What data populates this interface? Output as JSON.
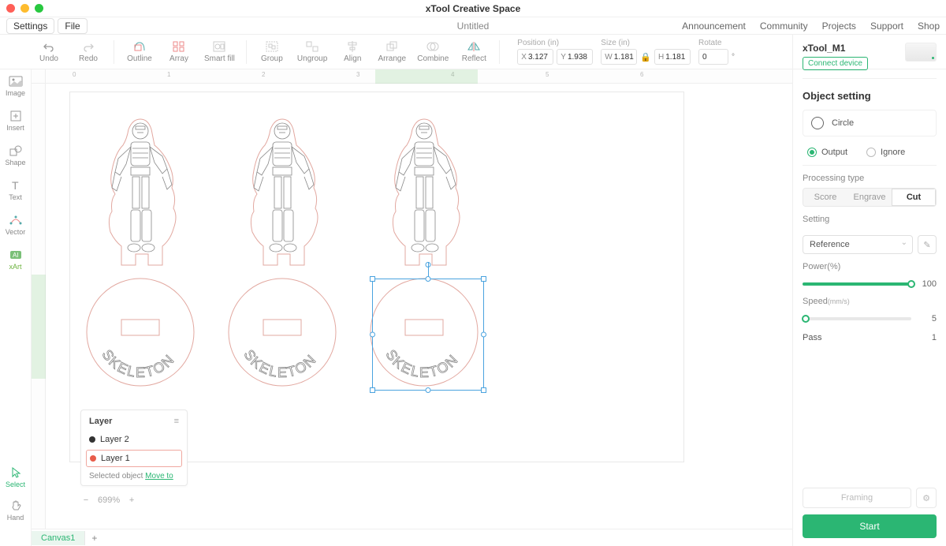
{
  "app": {
    "title": "xTool Creative Space",
    "document": "Untitled"
  },
  "menu": {
    "settings": "Settings",
    "file": "File"
  },
  "top_links": {
    "announcement": "Announcement",
    "community": "Community",
    "projects": "Projects",
    "support": "Support",
    "shop": "Shop"
  },
  "toolbar": {
    "undo": "Undo",
    "redo": "Redo",
    "outline": "Outline",
    "array": "Array",
    "smartfill": "Smart fill",
    "group": "Group",
    "ungroup": "Ungroup",
    "align": "Align",
    "arrange": "Arrange",
    "combine": "Combine",
    "reflect": "Reflect"
  },
  "inspector": {
    "position_label": "Position (in)",
    "x": "3.127",
    "y": "1.938",
    "size_label": "Size (in)",
    "w": "1.181",
    "h": "1.181",
    "rotate_label": "Rotate",
    "rotate": "0",
    "deg": "°"
  },
  "left_tools": {
    "image": "Image",
    "insert": "Insert",
    "shape": "Shape",
    "text": "Text",
    "vector": "Vector",
    "xart": "xArt",
    "select": "Select",
    "hand": "Hand"
  },
  "ruler_ticks": [
    "0",
    "1",
    "2",
    "3",
    "4",
    "5",
    "6"
  ],
  "layer": {
    "title": "Layer",
    "items": [
      {
        "name": "Layer 2",
        "color": "#333"
      },
      {
        "name": "Layer 1",
        "color": "#e85c4a"
      }
    ],
    "footer_text": "Selected object ",
    "move_to": "Move to"
  },
  "zoom": "699%",
  "canvas_tab": "Canvas1",
  "right": {
    "device_name": "xTool_M1",
    "connect": "Connect device",
    "object_setting": "Object setting",
    "shape_name": "Circle",
    "output": "Output",
    "ignore": "Ignore",
    "processing_type": "Processing type",
    "score": "Score",
    "engrave": "Engrave",
    "cut": "Cut",
    "setting": "Setting",
    "reference": "Reference",
    "power": "Power(%)",
    "power_val": "100",
    "speed": "Speed",
    "speed_unit": "(mm/s)",
    "speed_val": "5",
    "pass": "Pass",
    "pass_val": "1",
    "framing": "Framing",
    "start": "Start"
  },
  "artwork_text": "SKELETON"
}
